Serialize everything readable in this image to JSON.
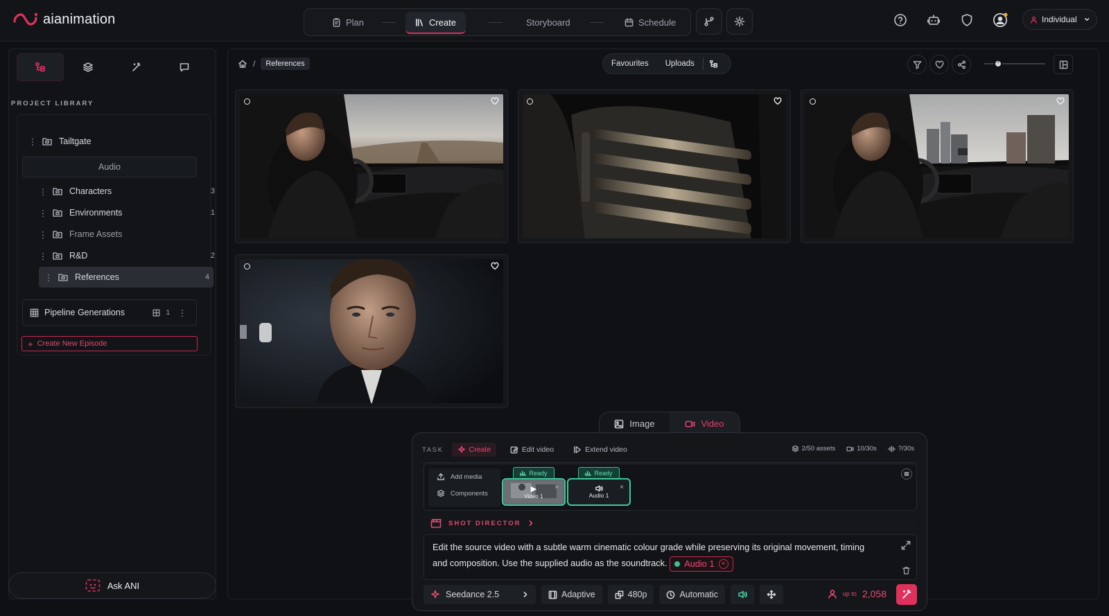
{
  "brand": {
    "name": "aianimation",
    "accent": "#e0315c"
  },
  "nav": {
    "tabs": [
      {
        "label": "Plan",
        "icon": "clipboard-icon"
      },
      {
        "label": "Create",
        "icon": "library-icon",
        "active": true
      },
      {
        "label": "Storyboard",
        "icon": ""
      },
      {
        "label": "Schedule",
        "icon": "calendar-icon"
      }
    ]
  },
  "account": {
    "mode_label": "Individual"
  },
  "sidebar": {
    "section_label": "PROJECT LIBRARY",
    "project": "Tailtgate",
    "audio_label": "Audio",
    "folders": [
      {
        "name": "Characters",
        "count": "3"
      },
      {
        "name": "Environments",
        "count": "1"
      },
      {
        "name": "Frame Assets",
        "count": ""
      },
      {
        "name": "R&D",
        "count": "2"
      },
      {
        "name": "References",
        "count": "4"
      }
    ],
    "pipeline": {
      "label": "Pipeline Generations",
      "count": "1"
    },
    "create_episode": "Create New Episode",
    "ask": "Ask ANI"
  },
  "main": {
    "breadcrumb": "References",
    "view_options": [
      "Favourites",
      "Uploads"
    ],
    "zoom_level": "3",
    "cards": [
      {
        "name": "card-driver-desert-road",
        "scene": "car-interior-desert"
      },
      {
        "name": "card-metal-grille",
        "scene": "grille"
      },
      {
        "name": "card-driver-city-road",
        "scene": "car-interior-city"
      },
      {
        "name": "card-man-portrait",
        "scene": "portrait"
      }
    ]
  },
  "modes": {
    "image": "Image",
    "video": "Video"
  },
  "composer": {
    "task_label": "TASK",
    "task_create": "Create",
    "task_edit": "Edit video",
    "task_extend": "Extend video",
    "meta_assets": "2/50 assets",
    "meta_video": "10/30s",
    "meta_audio": "?/30s",
    "add_media": "Add media",
    "components": "Components",
    "ready_label": "Ready",
    "video_chip": "Video 1",
    "audio_chip": "Audio 1",
    "shot_director": "SHOT DIRECTOR",
    "prompt_text": "Edit the source video with a subtle warm cinematic colour grade while preserving its original movement, timing and composition. Use the supplied audio as the soundtrack.",
    "prompt_tag": "Audio 1",
    "model": "Seedance 2.5",
    "aspect": "Adaptive",
    "resolution": "480p",
    "duration": "Automatic",
    "credits_prefix": "up to",
    "credits": "2,058"
  }
}
